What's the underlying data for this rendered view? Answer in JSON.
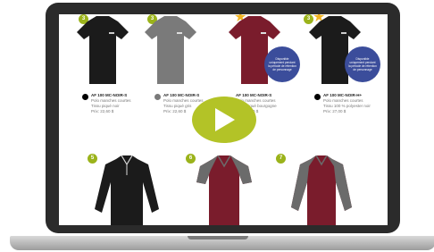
{
  "products_top": [
    {
      "badge": "3",
      "color": "#1b1b1b",
      "sku": "AF 100 MC-NOIR-S",
      "line1": "Polo manches courtes",
      "line2": "Tissu piqué noir",
      "price": "Prix: 22,60 $"
    },
    {
      "badge": "3",
      "color": "#7a7a7a",
      "sku": "AF 100 MC-NOIR-S",
      "line1": "Polo manches courtes",
      "line2": "Tissu piqué gris",
      "price": "Prix: 22,60 $"
    },
    {
      "badge": "",
      "color": "#7a1c2c",
      "sku": "AF 100 MC-NOIR-S",
      "line1": "Polo manches courtes",
      "line2": "Tissu piqué bourgogne",
      "price": "Prix: 22,60 $"
    },
    {
      "badge": "3",
      "color": "#1b1b1b",
      "sku": "AF 100 MC-NOIR-H+",
      "line1": "Polo manches courtes",
      "line2": "Tissu 100 % polyester noir",
      "price": "Prix: 27,00 $"
    }
  ],
  "seal_text": "Disponible uniquement pendant la période de rétention de personnage",
  "products_bottom": [
    {
      "badge": "5",
      "color": "#1b1b1b"
    },
    {
      "badge": "6",
      "color": "#7a1c2c"
    },
    {
      "badge": "7",
      "color": "#7a1c2c"
    }
  ],
  "accent": "#b3c327"
}
